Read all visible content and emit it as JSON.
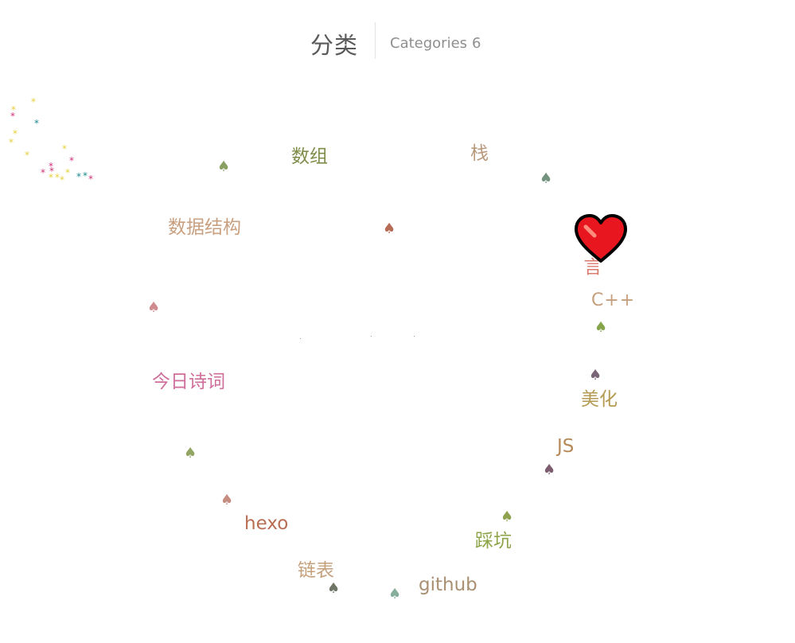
{
  "header": {
    "title": "分类",
    "subtitle": "Categories",
    "count": "6"
  },
  "categories": [
    {
      "label": "数组",
      "color": "#7f8d4a"
    },
    {
      "label": "栈",
      "color": "#b99a7d"
    },
    {
      "label": "数据结构",
      "color": "#c8a080"
    },
    {
      "label": "一言",
      "color": "#d97a6c"
    },
    {
      "label": "C++",
      "color": "#c6a07c"
    },
    {
      "label": "今日诗词",
      "color": "#cf6e9b"
    },
    {
      "label": "美化",
      "color": "#b49a53"
    },
    {
      "label": "JS",
      "color": "#b88a5a"
    },
    {
      "label": "hexo",
      "color": "#b86e55"
    },
    {
      "label": "踩坑",
      "color": "#8ea449"
    },
    {
      "label": "链表",
      "color": "#c4a17c"
    },
    {
      "label": "github",
      "color": "#a99073"
    }
  ],
  "spade_icon": {
    "name": "spade-icon",
    "glyph": "♠"
  },
  "spade_colors": [
    "#8aa063",
    "#73937f",
    "#b66b55",
    "#cf8b8e",
    "#86a54b",
    "#7a6577",
    "#92a562",
    "#7c5c6e",
    "#c48d80",
    "#8ea24f",
    "#6f7565",
    "#86ae9b"
  ],
  "heart_cursor": {
    "name": "heart-cursor-icon",
    "fill": "#e8161e",
    "outline": "#000000"
  },
  "star_glyph": "*",
  "star_colors": {
    "yellow": "#e6cf3b",
    "pink": "#d0317a",
    "teal": "#1a8a8f"
  }
}
